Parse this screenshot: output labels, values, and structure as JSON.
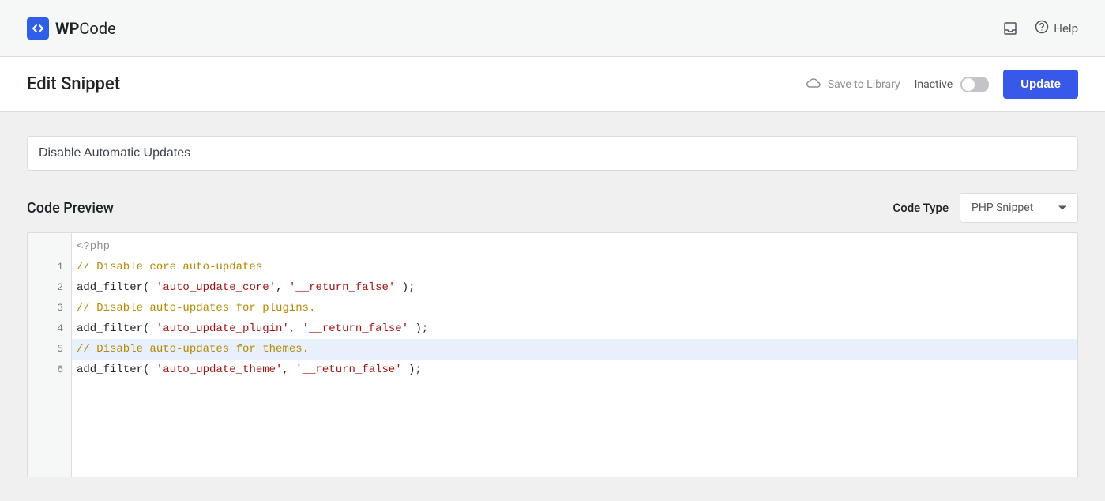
{
  "header": {
    "logo_bold": "WP",
    "logo_light": "Code",
    "help_label": "Help"
  },
  "subheader": {
    "page_title": "Edit Snippet",
    "save_to_library_label": "Save to Library",
    "status_label": "Inactive",
    "update_label": "Update"
  },
  "editor": {
    "snippet_title": "Disable Automatic Updates",
    "preview_heading": "Code Preview",
    "code_type_label": "Code Type",
    "code_type_value": "PHP Snippet",
    "line_numbers": [
      "1",
      "2",
      "3",
      "4",
      "5",
      "6"
    ],
    "lines": {
      "l0": "<?php",
      "l1": "// Disable core auto-updates",
      "l2_fn": "add_filter",
      "l2_s1": "'auto_update_core'",
      "l2_s2": "'__return_false'",
      "l3": "// Disable auto-updates for plugins.",
      "l4_fn": "add_filter",
      "l4_s1": "'auto_update_plugin'",
      "l4_s2": "'__return_false'",
      "l5": "// Disable auto-updates for themes.",
      "l6_fn": "add_filter",
      "l6_s1": "'auto_update_theme'",
      "l6_s2": "'__return_false'"
    }
  }
}
